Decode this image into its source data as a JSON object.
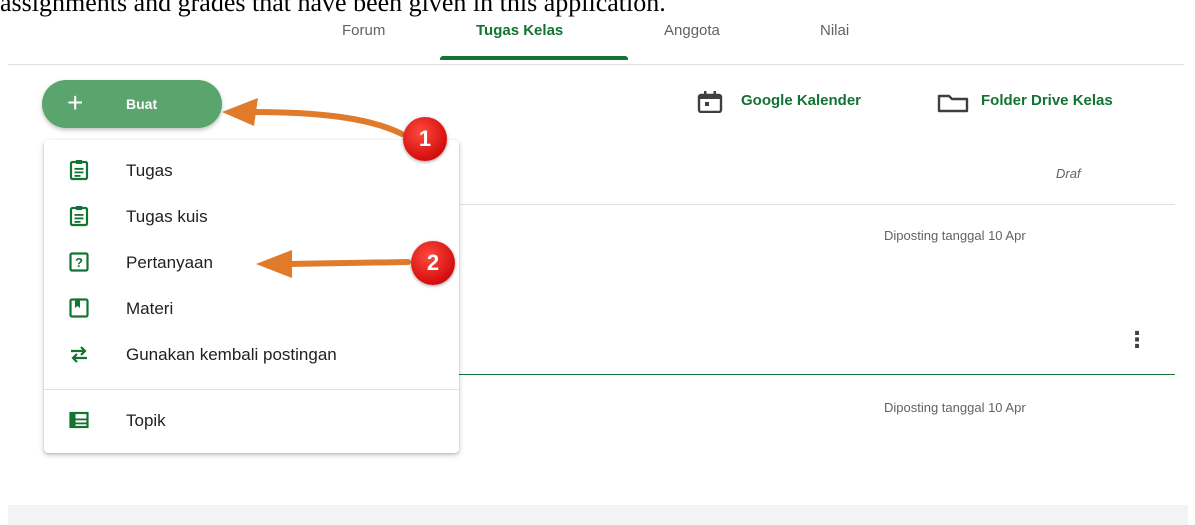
{
  "caption": "assignments and grades that have been given in this application.",
  "tabs": [
    {
      "label": "Forum"
    },
    {
      "label": "Tugas Kelas",
      "active": true
    },
    {
      "label": "Anggota"
    },
    {
      "label": "Nilai"
    }
  ],
  "create": {
    "label": "Buat"
  },
  "links": {
    "calendar": "Google Kalender",
    "drive": "Folder Drive Kelas"
  },
  "menu": {
    "items": [
      {
        "label": "Tugas",
        "icon": "assignment-icon"
      },
      {
        "label": "Tugas kuis",
        "icon": "quiz-assignment-icon"
      },
      {
        "label": "Pertanyaan",
        "icon": "question-icon"
      },
      {
        "label": "Materi",
        "icon": "material-icon"
      },
      {
        "label": "Gunakan kembali postingan",
        "icon": "reuse-icon"
      },
      {
        "label": "Topik",
        "icon": "topic-icon"
      }
    ]
  },
  "stream": {
    "draft": "Draf",
    "posted_1": "Diposting tanggal 10 Apr",
    "posted_2": "Diposting tanggal 10 Apr"
  },
  "annotations": {
    "badge_1": "1",
    "badge_2": "2"
  },
  "colors": {
    "accent": "#137333",
    "button": "#5aa46d",
    "arrow": "#e07b2c",
    "badge": "#d30e0e"
  }
}
